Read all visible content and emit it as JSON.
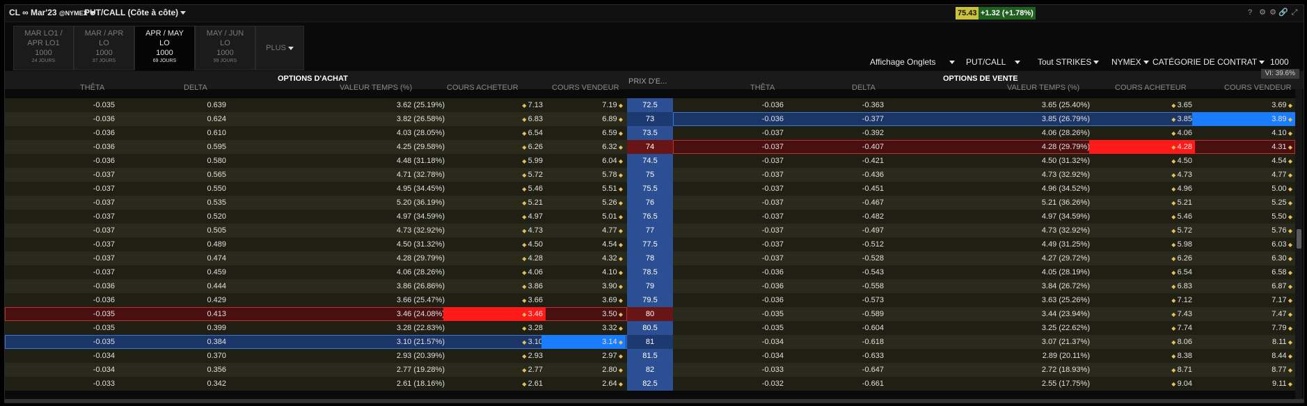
{
  "titlebar": {
    "symbol": "CL ∞ Mar'23",
    "exchange": "@NYMEX",
    "view": "PUT/CALL (Côte à côte)",
    "last_price": "75.43",
    "change": "+1.32",
    "change_pct": "(+1.78%)",
    "icons": [
      "help-icon",
      "settings-icon",
      "gear-icon",
      "link-icon",
      "expand-icon"
    ],
    "help_glyph": "?",
    "settings_glyph": "⚙",
    "gear_glyph": "⚙",
    "link_glyph": "🔗",
    "expand_glyph": "⤢"
  },
  "tabs": [
    {
      "line1": "MAR LO1 /",
      "line2": "APR LO1",
      "line3": "1000",
      "days": "24 JOURS",
      "active": false
    },
    {
      "line1": "MAR / APR",
      "line2": "LO",
      "line3": "1000",
      "days": "37 JOURS",
      "active": false
    },
    {
      "line1": "APR / MAY",
      "line2": "LO",
      "line3": "1000",
      "days": "69 JOURS",
      "active": true
    },
    {
      "line1": "MAY / JUN",
      "line2": "LO",
      "line3": "1000",
      "days": "99 JOURS",
      "active": false
    }
  ],
  "tab_more": "PLUS",
  "controls": {
    "display": "Affichage Onglets",
    "putcall": "PUT/CALL",
    "strikes": "Tout STRIKES",
    "exchange": "NYMEX",
    "category": "CATÉGORIE DE CONTRAT",
    "multiplier": "1000"
  },
  "vi": "VI: 39.6%",
  "sections": {
    "calls": "OPTIONS D'ACHAT",
    "puts": "OPTIONS DE VENTE",
    "strike": "PRIX D'E..."
  },
  "call_columns": [
    "THÊTA",
    "DELTA",
    "VALEUR TEMPS (%)",
    "COURS ACHETEUR",
    "COURS VENDEUR"
  ],
  "put_columns": [
    "THÊTA",
    "DELTA",
    "VALEUR TEMPS (%)",
    "COURS ACHETEUR",
    "COURS VENDEUR"
  ],
  "rows": [
    {
      "ct": "-0.035",
      "cd": "0.639",
      "cv": "3.62 (25.19%)",
      "cb": "7.13",
      "ca": "7.19",
      "k": "72.5",
      "pt": "-0.036",
      "pd": "-0.363",
      "pv": "3.65 (25.40%)",
      "pb": "3.65",
      "pa": "3.69"
    },
    {
      "ct": "-0.036",
      "cd": "0.624",
      "cv": "3.82 (26.58%)",
      "cb": "6.83",
      "ca": "6.89",
      "k": "73",
      "pt": "-0.036",
      "pd": "-0.377",
      "pv": "3.85 (26.79%)",
      "pb": "3.85",
      "pa": "3.89"
    },
    {
      "ct": "-0.036",
      "cd": "0.610",
      "cv": "4.03 (28.05%)",
      "cb": "6.54",
      "ca": "6.59",
      "k": "73.5",
      "pt": "-0.037",
      "pd": "-0.392",
      "pv": "4.06 (28.26%)",
      "pb": "4.06",
      "pa": "4.10"
    },
    {
      "ct": "-0.036",
      "cd": "0.595",
      "cv": "4.25 (29.58%)",
      "cb": "6.26",
      "ca": "6.32",
      "k": "74",
      "pt": "-0.037",
      "pd": "-0.407",
      "pv": "4.28 (29.79%)",
      "pb": "4.28",
      "pa": "4.31"
    },
    {
      "ct": "-0.036",
      "cd": "0.580",
      "cv": "4.48 (31.18%)",
      "cb": "5.99",
      "ca": "6.04",
      "k": "74.5",
      "pt": "-0.037",
      "pd": "-0.421",
      "pv": "4.50 (31.32%)",
      "pb": "4.50",
      "pa": "4.54"
    },
    {
      "ct": "-0.037",
      "cd": "0.565",
      "cv": "4.71 (32.78%)",
      "cb": "5.72",
      "ca": "5.78",
      "k": "75",
      "pt": "-0.037",
      "pd": "-0.436",
      "pv": "4.73 (32.92%)",
      "pb": "4.73",
      "pa": "4.77"
    },
    {
      "ct": "-0.037",
      "cd": "0.550",
      "cv": "4.95 (34.45%)",
      "cb": "5.46",
      "ca": "5.51",
      "k": "75.5",
      "pt": "-0.037",
      "pd": "-0.451",
      "pv": "4.96 (34.52%)",
      "pb": "4.96",
      "pa": "5.00"
    },
    {
      "ct": "-0.037",
      "cd": "0.535",
      "cv": "5.20 (36.19%)",
      "cb": "5.21",
      "ca": "5.26",
      "k": "76",
      "pt": "-0.037",
      "pd": "-0.467",
      "pv": "5.21 (36.26%)",
      "pb": "5.21",
      "pa": "5.25"
    },
    {
      "ct": "-0.037",
      "cd": "0.520",
      "cv": "4.97 (34.59%)",
      "cb": "4.97",
      "ca": "5.01",
      "k": "76.5",
      "pt": "-0.037",
      "pd": "-0.482",
      "pv": "4.97 (34.59%)",
      "pb": "5.46",
      "pa": "5.50"
    },
    {
      "ct": "-0.037",
      "cd": "0.505",
      "cv": "4.73 (32.92%)",
      "cb": "4.73",
      "ca": "4.77",
      "k": "77",
      "pt": "-0.037",
      "pd": "-0.497",
      "pv": "4.73 (32.92%)",
      "pb": "5.72",
      "pa": "5.76"
    },
    {
      "ct": "-0.037",
      "cd": "0.489",
      "cv": "4.50 (31.32%)",
      "cb": "4.50",
      "ca": "4.54",
      "k": "77.5",
      "pt": "-0.037",
      "pd": "-0.512",
      "pv": "4.49 (31.25%)",
      "pb": "5.98",
      "pa": "6.03"
    },
    {
      "ct": "-0.037",
      "cd": "0.474",
      "cv": "4.28 (29.79%)",
      "cb": "4.28",
      "ca": "4.32",
      "k": "78",
      "pt": "-0.037",
      "pd": "-0.528",
      "pv": "4.27 (29.72%)",
      "pb": "6.26",
      "pa": "6.30"
    },
    {
      "ct": "-0.037",
      "cd": "0.459",
      "cv": "4.06 (28.26%)",
      "cb": "4.06",
      "ca": "4.10",
      "k": "78.5",
      "pt": "-0.036",
      "pd": "-0.543",
      "pv": "4.05 (28.19%)",
      "pb": "6.54",
      "pa": "6.58"
    },
    {
      "ct": "-0.036",
      "cd": "0.444",
      "cv": "3.86 (26.86%)",
      "cb": "3.86",
      "ca": "3.90",
      "k": "79",
      "pt": "-0.036",
      "pd": "-0.558",
      "pv": "3.84 (26.72%)",
      "pb": "6.83",
      "pa": "6.87"
    },
    {
      "ct": "-0.036",
      "cd": "0.429",
      "cv": "3.66 (25.47%)",
      "cb": "3.66",
      "ca": "3.69",
      "k": "79.5",
      "pt": "-0.036",
      "pd": "-0.573",
      "pv": "3.63 (25.26%)",
      "pb": "7.12",
      "pa": "7.17"
    },
    {
      "ct": "-0.035",
      "cd": "0.413",
      "cv": "3.46 (24.08%)",
      "cb": "3.46",
      "ca": "3.50",
      "k": "80",
      "pt": "-0.035",
      "pd": "-0.589",
      "pv": "3.44 (23.94%)",
      "pb": "7.43",
      "pa": "7.47"
    },
    {
      "ct": "-0.035",
      "cd": "0.399",
      "cv": "3.28 (22.83%)",
      "cb": "3.28",
      "ca": "3.32",
      "k": "80.5",
      "pt": "-0.035",
      "pd": "-0.604",
      "pv": "3.25 (22.62%)",
      "pb": "7.74",
      "pa": "7.79"
    },
    {
      "ct": "-0.035",
      "cd": "0.384",
      "cv": "3.10 (21.57%)",
      "cb": "3.10",
      "ca": "3.14",
      "k": "81",
      "pt": "-0.034",
      "pd": "-0.618",
      "pv": "3.07 (21.37%)",
      "pb": "8.06",
      "pa": "8.11"
    },
    {
      "ct": "-0.034",
      "cd": "0.370",
      "cv": "2.93 (20.39%)",
      "cb": "2.93",
      "ca": "2.97",
      "k": "81.5",
      "pt": "-0.034",
      "pd": "-0.633",
      "pv": "2.89 (20.11%)",
      "pb": "8.38",
      "pa": "8.44"
    },
    {
      "ct": "-0.034",
      "cd": "0.356",
      "cv": "2.77 (19.28%)",
      "cb": "2.77",
      "ca": "2.80",
      "k": "82",
      "pt": "-0.033",
      "pd": "-0.647",
      "pv": "2.72 (18.93%)",
      "pb": "8.71",
      "pa": "8.77"
    },
    {
      "ct": "-0.033",
      "cd": "0.342",
      "cv": "2.61 (18.16%)",
      "cb": "2.61",
      "ca": "2.64",
      "k": "82.5",
      "pt": "-0.032",
      "pd": "-0.661",
      "pv": "2.55 (17.75%)",
      "pb": "9.04",
      "pa": "9.11"
    }
  ],
  "row_styles": {
    "1": {
      "put": "selected-blue"
    },
    "3": {
      "put": "highlight-red"
    },
    "15": {
      "call": "highlight-red"
    },
    "17": {
      "call": "selected-blue"
    }
  },
  "colors": {
    "bg": "#0a0a0a",
    "row_odd": "#1f1f14",
    "row_even": "#2a2a1c",
    "strike": "#2c4f94",
    "red_row": "#4a1010",
    "red_cell": "#ff1a1a",
    "blue_row": "#1b3566",
    "blue_cell": "#1a7cff",
    "price_bg": "#c9c23a",
    "change_bg": "#1f5f1f"
  }
}
